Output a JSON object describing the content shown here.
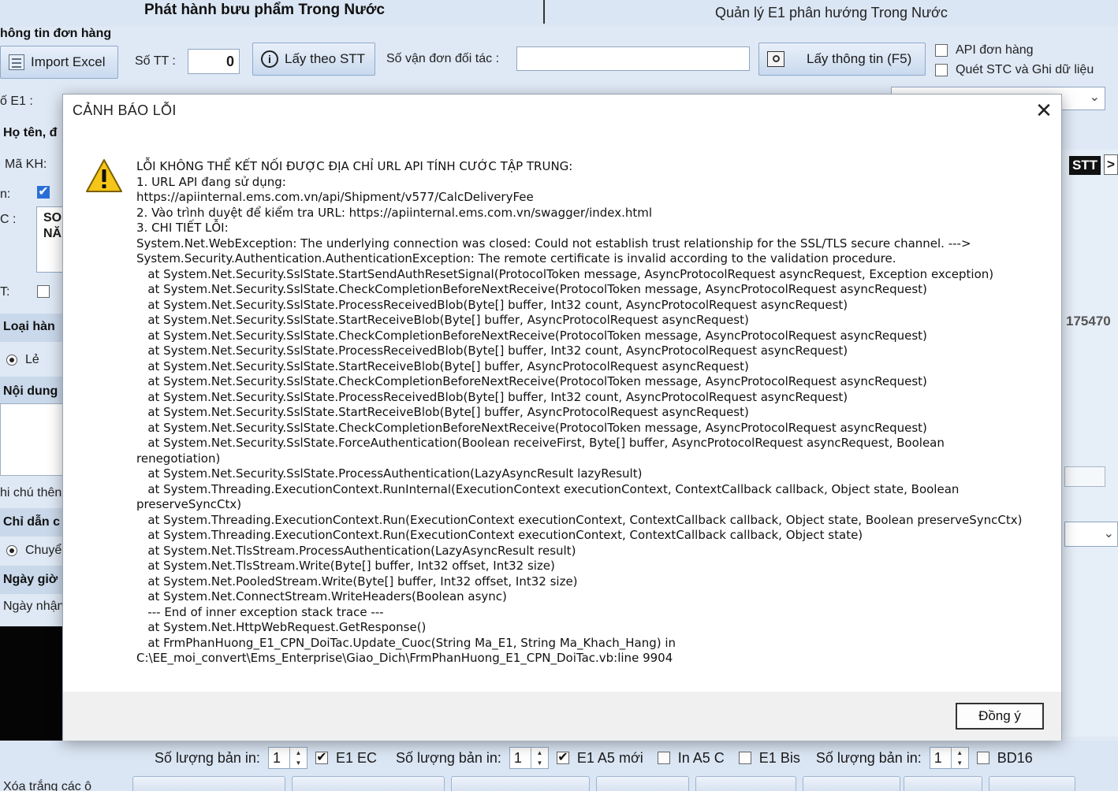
{
  "header": {
    "title_left": "Phát hành bưu phẩm Trong Nước",
    "title_right": "Quản lý E1 phân hướng Trong Nước"
  },
  "toolbar": {
    "section_label": "hông tin đơn hàng",
    "import_excel": "Import Excel",
    "stt_label": "Số TT :",
    "stt_value": "0",
    "lay_theo_stt": "Lấy theo STT",
    "so_van_don_label": "Số vận đơn đối tác :",
    "so_van_don_value": "",
    "lay_thong_tin": "Lấy thông tin (F5)",
    "api_don_hang": "API đơn hàng",
    "quet_stc": "Quét STC và Ghi dữ liệu"
  },
  "left_panel": {
    "so_e1": "ố E1 :",
    "ho_ten": "Họ tên, đ",
    "ma_kh": "Mã KH:",
    "row_n": "n:",
    "row_c": "C :",
    "c_text_1": "SO",
    "c_text_2": "NĂ",
    "row_t": "T:",
    "loai_hang": "Loại hàn",
    "le": "Lẻ",
    "noi_dung": "Nội dung",
    "ghi_chu": "hi chú thên",
    "chi_dan": "Chỉ dẫn c",
    "chuyen": "Chuyể",
    "ngay_gio": "Ngày giờ",
    "ngay_nhan": "Ngày nhận"
  },
  "right_panel": {
    "stt_tag": "STT",
    "arrow": ">",
    "number": "175470"
  },
  "bottom": {
    "so_luong_label": "Số lượng bản in:",
    "spin_values": [
      "1",
      "1",
      "1"
    ],
    "e1ec": "E1 EC",
    "e1a5moi": "E1 A5 mới",
    "ina5c": "In A5 C",
    "e1bis": "E1 Bis",
    "bd16": "BD16",
    "xoa_trang": "Xóa trắng các ô"
  },
  "dialog": {
    "title": "CẢNH BÁO LỖI",
    "close_glyph": "✕",
    "icon": "warning-icon",
    "ok_label": "Đồng ý",
    "message_lines": [
      "LỖI KHÔNG THỂ KẾT NỐI ĐƯỢC ĐỊA CHỈ URL API TÍNH CƯỚC TẬP TRUNG:",
      "1. URL API đang sử dụng:",
      "https://apiinternal.ems.com.vn/api/Shipment/v577/CalcDeliveryFee",
      "2. Vào trình duyệt để kiểm tra URL: https://apiinternal.ems.com.vn/swagger/index.html",
      "3. CHI TIẾT LỖI:",
      "System.Net.WebException: The underlying connection was closed: Could not establish trust relationship for the SSL/TLS secure channel. --->",
      "System.Security.Authentication.AuthenticationException: The remote certificate is invalid according to the validation procedure.",
      "   at System.Net.Security.SslState.StartSendAuthResetSignal(ProtocolToken message, AsyncProtocolRequest asyncRequest, Exception exception)",
      "   at System.Net.Security.SslState.CheckCompletionBeforeNextReceive(ProtocolToken message, AsyncProtocolRequest asyncRequest)",
      "   at System.Net.Security.SslState.ProcessReceivedBlob(Byte[] buffer, Int32 count, AsyncProtocolRequest asyncRequest)",
      "   at System.Net.Security.SslState.StartReceiveBlob(Byte[] buffer, AsyncProtocolRequest asyncRequest)",
      "   at System.Net.Security.SslState.CheckCompletionBeforeNextReceive(ProtocolToken message, AsyncProtocolRequest asyncRequest)",
      "   at System.Net.Security.SslState.ProcessReceivedBlob(Byte[] buffer, Int32 count, AsyncProtocolRequest asyncRequest)",
      "   at System.Net.Security.SslState.StartReceiveBlob(Byte[] buffer, AsyncProtocolRequest asyncRequest)",
      "   at System.Net.Security.SslState.CheckCompletionBeforeNextReceive(ProtocolToken message, AsyncProtocolRequest asyncRequest)",
      "   at System.Net.Security.SslState.ProcessReceivedBlob(Byte[] buffer, Int32 count, AsyncProtocolRequest asyncRequest)",
      "   at System.Net.Security.SslState.StartReceiveBlob(Byte[] buffer, AsyncProtocolRequest asyncRequest)",
      "   at System.Net.Security.SslState.CheckCompletionBeforeNextReceive(ProtocolToken message, AsyncProtocolRequest asyncRequest)",
      "   at System.Net.Security.SslState.ForceAuthentication(Boolean receiveFirst, Byte[] buffer, AsyncProtocolRequest asyncRequest, Boolean",
      "renegotiation)",
      "   at System.Net.Security.SslState.ProcessAuthentication(LazyAsyncResult lazyResult)",
      "   at System.Threading.ExecutionContext.RunInternal(ExecutionContext executionContext, ContextCallback callback, Object state, Boolean",
      "preserveSyncCtx)",
      "   at System.Threading.ExecutionContext.Run(ExecutionContext executionContext, ContextCallback callback, Object state, Boolean preserveSyncCtx)",
      "   at System.Threading.ExecutionContext.Run(ExecutionContext executionContext, ContextCallback callback, Object state)",
      "   at System.Net.TlsStream.ProcessAuthentication(LazyAsyncResult result)",
      "   at System.Net.TlsStream.Write(Byte[] buffer, Int32 offset, Int32 size)",
      "   at System.Net.PooledStream.Write(Byte[] buffer, Int32 offset, Int32 size)",
      "   at System.Net.ConnectStream.WriteHeaders(Boolean async)",
      "   --- End of inner exception stack trace ---",
      "   at System.Net.HttpWebRequest.GetResponse()",
      "   at FrmPhanHuong_E1_CPN_DoiTac.Update_Cuoc(String Ma_E1, String Ma_Khach_Hang) in",
      "C:\\EE_moi_convert\\Ems_Enterprise\\Giao_Dich\\FrmPhanHuong_E1_CPN_DoiTac.vb:line 9904"
    ]
  }
}
